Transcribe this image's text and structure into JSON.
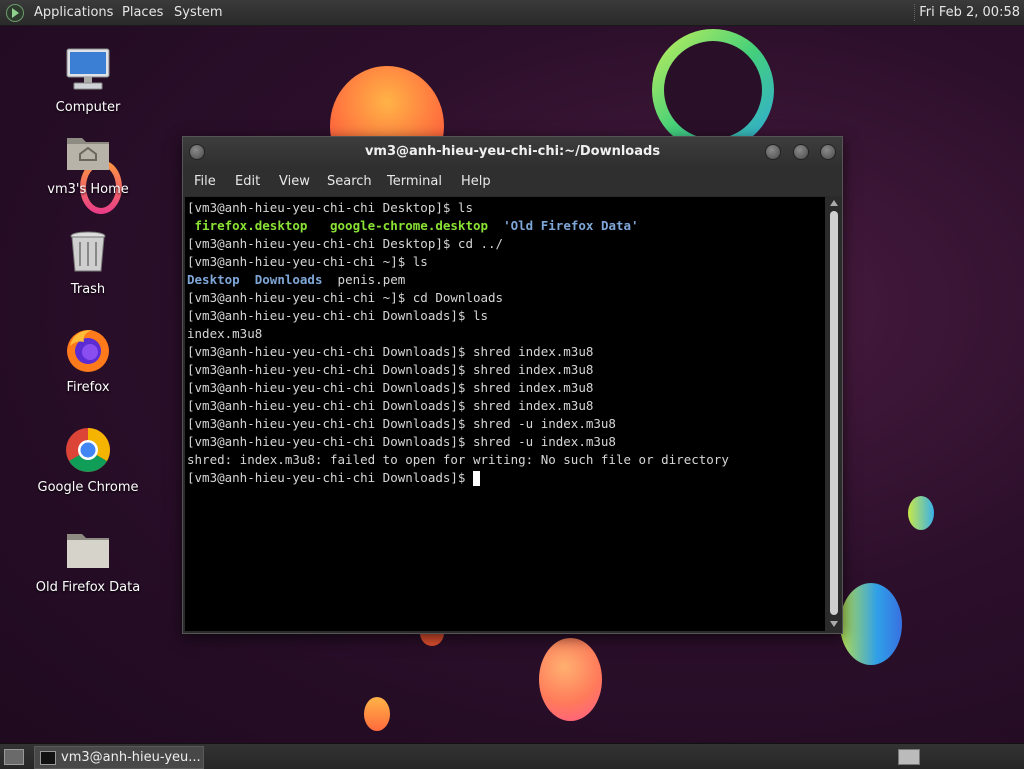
{
  "top_panel": {
    "menus": [
      "Applications",
      "Places",
      "System"
    ],
    "clock": "Fri Feb  2, 00:58"
  },
  "desktop_icons": [
    {
      "label": "Computer",
      "icon": "computer-icon"
    },
    {
      "label": "vm3's Home",
      "icon": "home-folder-icon"
    },
    {
      "label": "Trash",
      "icon": "trash-icon"
    },
    {
      "label": "Firefox",
      "icon": "firefox-icon"
    },
    {
      "label": "Google Chrome",
      "icon": "chrome-icon"
    },
    {
      "label": "Old Firefox Data",
      "icon": "folder-icon"
    }
  ],
  "window": {
    "title": "vm3@anh-hieu-yeu-chi-chi:~/Downloads",
    "menu": [
      "File",
      "Edit",
      "View",
      "Search",
      "Terminal",
      "Help"
    ]
  },
  "terminal": {
    "lines": [
      "[vm3@anh-hieu-yeu-chi-chi Desktop]$ ls",
      "",
      "[vm3@anh-hieu-yeu-chi-chi Desktop]$ cd ../",
      "[vm3@anh-hieu-yeu-chi-chi ~]$ ls",
      "",
      "[vm3@anh-hieu-yeu-chi-chi ~]$ cd Downloads",
      "[vm3@anh-hieu-yeu-chi-chi Downloads]$ ls",
      "index.m3u8",
      "[vm3@anh-hieu-yeu-chi-chi Downloads]$ shred index.m3u8",
      "[vm3@anh-hieu-yeu-chi-chi Downloads]$ shred index.m3u8",
      "[vm3@anh-hieu-yeu-chi-chi Downloads]$ shred index.m3u8",
      "[vm3@anh-hieu-yeu-chi-chi Downloads]$ shred index.m3u8",
      "[vm3@anh-hieu-yeu-chi-chi Downloads]$ shred -u index.m3u8",
      "[vm3@anh-hieu-yeu-chi-chi Downloads]$ shred -u index.m3u8",
      "shred: index.m3u8: failed to open for writing: No such file or directory",
      "[vm3@anh-hieu-yeu-chi-chi Downloads]$ "
    ],
    "desktop_ls": {
      "f1": "firefox.desktop",
      "f2": "google-chrome.desktop",
      "f3": "'Old Firefox Data'"
    },
    "home_ls": {
      "d1": "Desktop",
      "d2": "Downloads",
      "f1": "penis.pem"
    }
  },
  "taskbar": {
    "task_label": "vm3@anh-hieu-yeu..."
  },
  "colors": {
    "executable": "#8ae234",
    "directory": "#7ea7d8",
    "quoted": "#e8e8a0"
  }
}
